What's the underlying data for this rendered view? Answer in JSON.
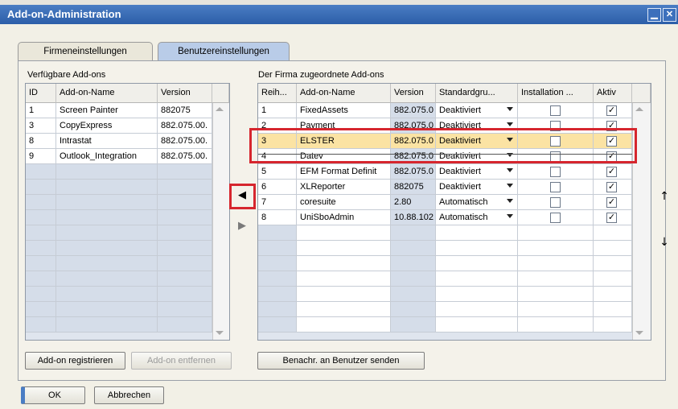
{
  "window": {
    "title": "Add-on-Administration"
  },
  "tabs": [
    "Firmeneinstellungen",
    "Benutzereinstellungen"
  ],
  "available": {
    "label": "Verfügbare Add-ons",
    "headers": [
      "ID",
      "Add-on-Name",
      "Version"
    ],
    "rows": [
      [
        "1",
        "Screen Painter",
        "882075"
      ],
      [
        "3",
        "CopyExpress",
        "882.075.00."
      ],
      [
        "8",
        "Intrastat",
        "882.075.00."
      ],
      [
        "9",
        "Outlook_Integration",
        "882.075.00."
      ]
    ],
    "empty_rows": 11
  },
  "assigned": {
    "label": "Der Firma zugeordnete Add-ons",
    "headers": [
      "Reih...",
      "Add-on-Name",
      "Version",
      "Standardgru...",
      "Installation ...",
      "Aktiv"
    ],
    "rows": [
      {
        "order": "1",
        "name": "FixedAssets",
        "version": "882.075.0",
        "group": "Deaktiviert",
        "install": false,
        "active": true
      },
      {
        "order": "2",
        "name": "Payment",
        "version": "882.075.0",
        "group": "Deaktiviert",
        "install": false,
        "active": true
      },
      {
        "order": "3",
        "name": "ELSTER",
        "version": "882.075.0",
        "group": "Deaktiviert",
        "install": false,
        "active": true
      },
      {
        "order": "4",
        "name": "Datev",
        "version": "882.075.0",
        "group": "Deaktiviert",
        "install": false,
        "active": true
      },
      {
        "order": "5",
        "name": "EFM Format Definit",
        "version": "882.075.0",
        "group": "Deaktiviert",
        "install": false,
        "active": true
      },
      {
        "order": "6",
        "name": "XLReporter",
        "version": "882075",
        "group": "Deaktiviert",
        "install": false,
        "active": true
      },
      {
        "order": "7",
        "name": "coresuite",
        "version": "2.80",
        "group": "Automatisch",
        "install": false,
        "active": true
      },
      {
        "order": "8",
        "name": "UniSboAdmin",
        "version": "10.88.102",
        "group": "Automatisch",
        "install": false,
        "active": true
      }
    ],
    "empty_rows": 7,
    "highlight_index": 2
  },
  "buttons": {
    "register": "Add-on registrieren",
    "remove": "Add-on entfernen",
    "notify": "Benachr. an Benutzer senden",
    "ok": "OK",
    "cancel": "Abbrechen"
  },
  "icons": {
    "move_left": "arrow-left-icon",
    "move_right": "arrow-right-icon",
    "move_up": "arrow-up-icon",
    "move_down": "arrow-down-icon"
  },
  "colors": {
    "title": "#2c5ea8",
    "highlight": "#fbe3a3",
    "annotation": "#d6262e",
    "inactive_tab": "#b9cce8"
  }
}
